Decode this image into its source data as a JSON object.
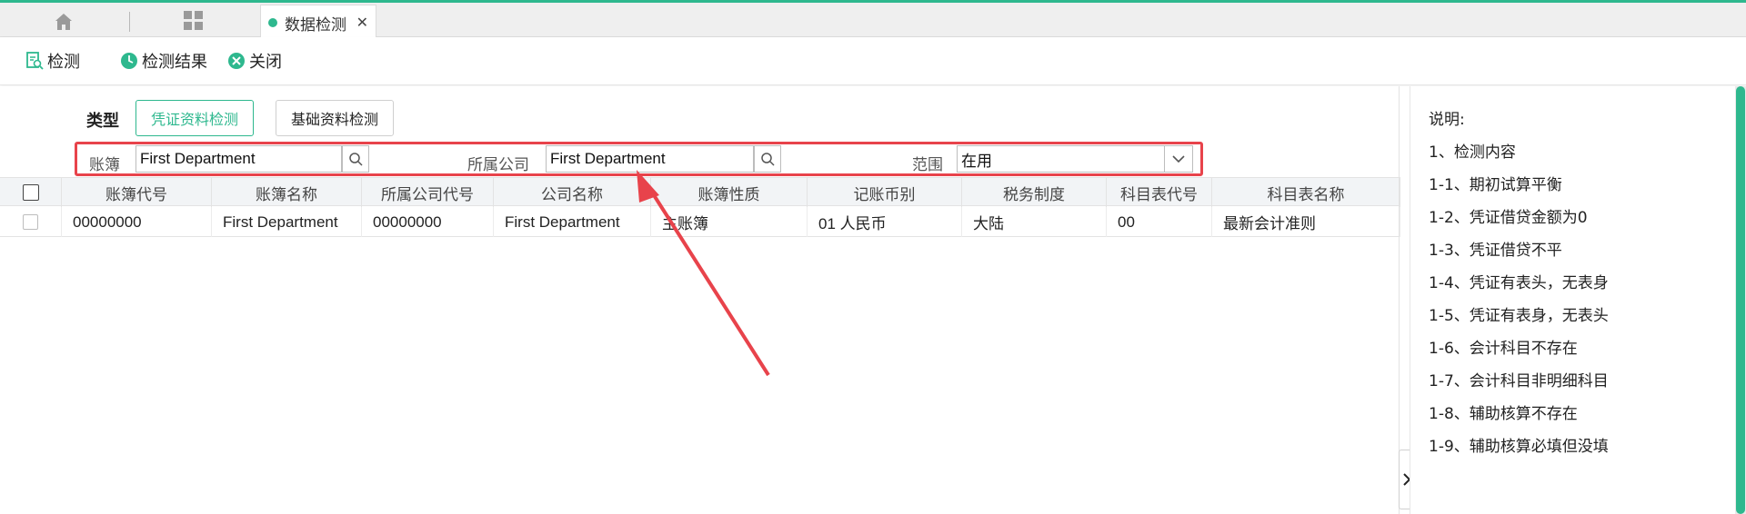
{
  "tabs": {
    "active_label": "数据检测",
    "close_glyph": "✕"
  },
  "toolbar": {
    "detect_label": "检测",
    "result_label": "检测结果",
    "close_label": "关闭"
  },
  "type_row": {
    "label": "类型",
    "buttons": [
      "凭证资料检测",
      "基础资料检测"
    ]
  },
  "filters": {
    "ledger_label": "账簿",
    "ledger_value": "First Department",
    "company_label": "所属公司",
    "company_value": "First Department",
    "scope_label": "范围",
    "scope_value": "在用"
  },
  "table": {
    "headers": [
      "账簿代号",
      "账簿名称",
      "所属公司代号",
      "公司名称",
      "账簿性质",
      "记账币别",
      "税务制度",
      "科目表代号",
      "科目表名称"
    ],
    "rows": [
      [
        "00000000",
        "First Department",
        "00000000",
        "First Department",
        "主账簿",
        "01 人民币",
        "大陆",
        "00",
        "最新会计准则"
      ]
    ]
  },
  "notes": {
    "title": "说明:",
    "lines": [
      "1、检测内容",
      "1-1、期初试算平衡",
      "1-2、凭证借贷金额为0",
      "1-3、凭证借贷不平",
      "1-4、凭证有表头，无表身",
      "1-5、凭证有表身，无表头",
      "1-6、会计科目不存在",
      "1-7、会计科目非明细科目",
      "1-8、辅助核算不存在",
      "1-9、辅助核算必填但没填"
    ]
  },
  "colors": {
    "accent": "#2eb88e",
    "annotation_red": "#e8434b"
  }
}
